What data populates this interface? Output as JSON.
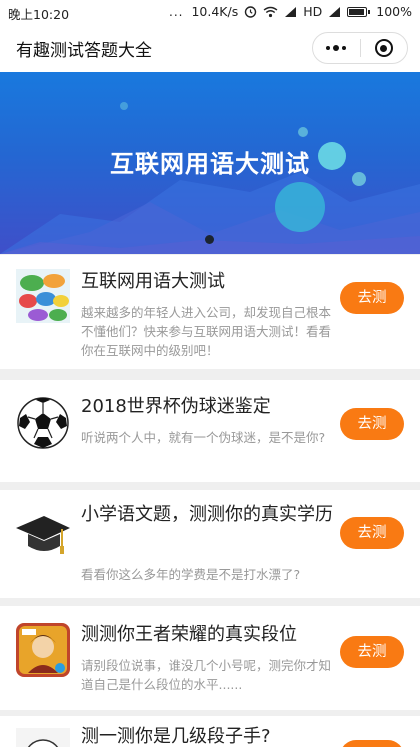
{
  "status_bar": {
    "time": "晚上10:20",
    "dots": "...",
    "speed": "10.4K/s",
    "network": "HD",
    "battery": "100%",
    "battery_level": 1.0
  },
  "navbar": {
    "title": "有趣测试答题大全"
  },
  "banner": {
    "title": "互联网用语大测试",
    "active_slide": 1,
    "slide_count": 1
  },
  "quizzes": [
    {
      "title": "互联网用语大测试",
      "description": "越来越多的年轻人进入公司，却发现自己根本不懂他们？快来参与互联网用语大测试！看看你在互联网中的级别吧！",
      "button": "去测",
      "icon": "speech-bubbles-icon"
    },
    {
      "title": "2018世界杯伪球迷鉴定",
      "description": "听说两个人中，就有一个伪球迷，是不是你?",
      "button": "去测",
      "icon": "soccer-ball-icon"
    },
    {
      "title": "小学语文题，测测你的真实学历",
      "description": "看看你这么多年的学费是不是打水漂了?",
      "button": "去测",
      "icon": "graduation-cap-icon"
    },
    {
      "title": "测测你王者荣耀的真实段位",
      "description": "请别段位说事，谁没几个小号呢，测完你才知道自己是什么段位的水平......",
      "button": "去测",
      "icon": "game-hero-icon"
    },
    {
      "title": "测一测你是几级段子手?",
      "description": "",
      "button": "去测",
      "icon": "meme-icon"
    }
  ],
  "colors": {
    "accent": "#f97a13",
    "banner_top": "#1979de",
    "banner_bottom": "#3f4fc9"
  }
}
